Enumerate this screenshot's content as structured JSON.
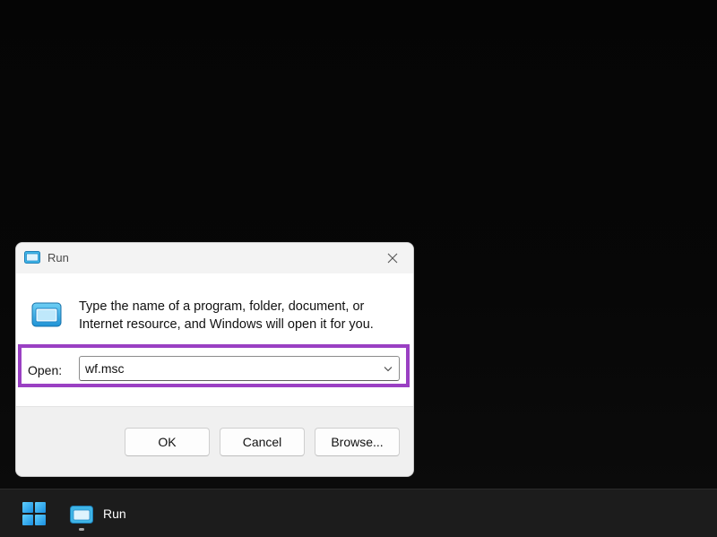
{
  "dialog": {
    "title": "Run",
    "title_icon": "run-icon",
    "close_icon": "close-icon",
    "description": "Type the name of a program, folder, document, or Internet resource, and Windows will open it for you.",
    "open_label": "Open:",
    "open_value": "wf.msc",
    "dropdown_icon": "chevron-down-icon",
    "buttons": {
      "ok": "OK",
      "cancel": "Cancel",
      "browse": "Browse..."
    },
    "highlight_color": "#9a40c3"
  },
  "taskbar": {
    "start_icon": "windows-start-icon",
    "items": [
      {
        "label": "Run",
        "icon": "run-icon",
        "active": true
      }
    ]
  }
}
